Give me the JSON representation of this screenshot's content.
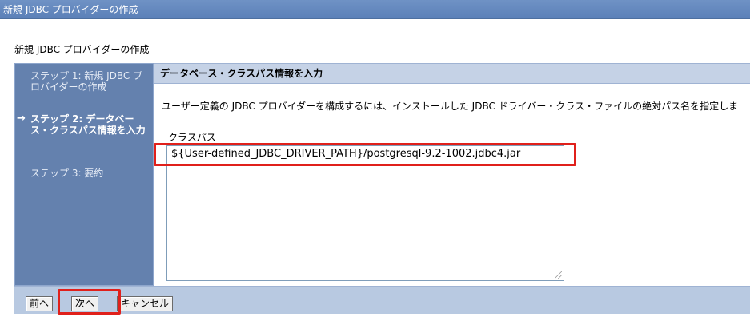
{
  "window": {
    "title": "新規 JDBC プロバイダーの作成"
  },
  "page": {
    "heading": "新規 JDBC プロバイダーの作成"
  },
  "steps": [
    {
      "label": "ステップ 1: 新規 JDBC プロバイダーの作成",
      "state": "done"
    },
    {
      "label": "ステップ 2: データベース・クラスパス情報を入力",
      "state": "current"
    },
    {
      "label": "ステップ 3: 要約",
      "state": "todo"
    }
  ],
  "content": {
    "header": "データベース・クラスパス情報を入力",
    "description": "ユーザー定義の JDBC プロバイダーを構成するには、インストールした JDBC ドライバー・クラス・ファイルの絶対パス名を指定しま",
    "classpath_label": "クラスパス",
    "classpath_value": "${User-defined_JDBC_DRIVER_PATH}/postgresql-9.2-1002.jdbc4.jar"
  },
  "buttons": {
    "previous": "前へ",
    "next": "次へ",
    "cancel": "キャンセル"
  },
  "colors": {
    "highlight": "#e0201b",
    "sidebar": "#6481ae",
    "header": "#c5d2e6"
  }
}
